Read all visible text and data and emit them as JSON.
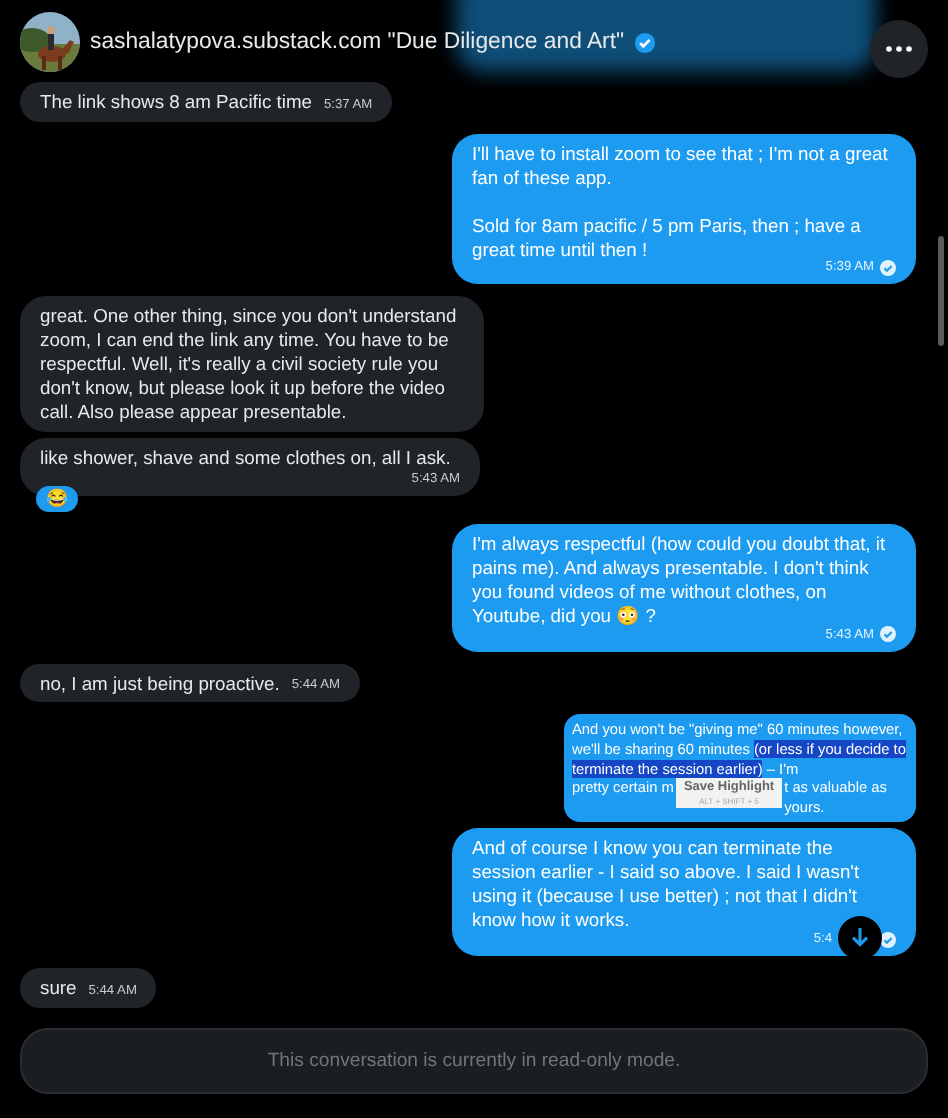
{
  "header": {
    "title": "sashalatypova.substack.com \"Due Diligence and Art\"",
    "verified": true
  },
  "messages": [
    {
      "kind": "received",
      "text": "The link shows 8 am Pacific time",
      "time": "5:37 AM",
      "read": false
    },
    {
      "kind": "sent",
      "text": "I'll have to install zoom to see that ; I'm not a great fan of these app.\n\nSold for 8am pacific / 5 pm Paris, then ; have a great time until then !",
      "time": "5:39 AM",
      "read": true
    },
    {
      "kind": "received",
      "text": "great.  One other thing, since you don't understand zoom, I can end the link any time. You have to be respectful. Well, it's really a civil society rule you don't know, but please look it up before the video call.  Also please appear presentable.",
      "read": false
    },
    {
      "kind": "received",
      "text": "like shower, shave and some clothes on, all I ask.",
      "time": "5:43 AM",
      "read": false,
      "reaction": "😂"
    },
    {
      "kind": "sent",
      "text": "I'm always respectful (how could you doubt that, it pains me). And always presentable. I don't think you found videos of me without clothes, on Youtube, did you 😳 ?",
      "time": "5:43 AM",
      "read": true
    },
    {
      "kind": "received",
      "text": "no, I am just being proactive.",
      "time": "5:44 AM",
      "read": false
    },
    {
      "kind": "highlight",
      "before": "And you won't be \"giving me\" 60 minutes however, we'll be sharing 60 minutes",
      "selected": "(or less if you decide to terminate the session earlier)",
      "after": " – I'm",
      "cut": "pretty certain m",
      "tail": "t as valuable as yours.",
      "tooltip": {
        "label": "Save Highlight",
        "shortcut": "ALT + SHIFT + 5"
      },
      "read": false
    },
    {
      "kind": "sent",
      "text": "And of course I know you can terminate the session earlier - I said so above. I said I wasn't using it (because I use better) ; not that I didn't know how it works.",
      "time": "5:4",
      "read": true,
      "scroll_button": true
    },
    {
      "kind": "received",
      "text": "sure",
      "time": "5:44 AM",
      "read": false
    }
  ],
  "footer": {
    "notice": "This conversation is currently in read-only mode."
  }
}
